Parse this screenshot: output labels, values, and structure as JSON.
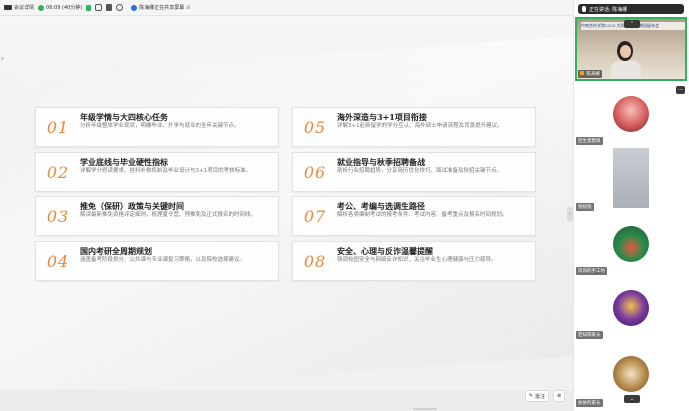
{
  "topbar": {
    "app_name": "会议详情",
    "meeting_time": "06:09 (40分钟)",
    "recording_label": "陈海娜正在共享屏幕"
  },
  "slide": {
    "items": [
      {
        "num": "01",
        "title": "年级学情与大四核心任务",
        "desc": "分析年级整体学业现状，明确毕业、升学与就业的全年关键节点。"
      },
      {
        "num": "02",
        "title": "学业底线与毕业硬性指标",
        "desc": "详解学分修读要求、挂科补救机制及毕业设计与3+1项目的考核标准。"
      },
      {
        "num": "03",
        "title": "推免（保研）政策与关键时间",
        "desc": "解读最新推免资格评定细则，梳理夏令营、预推免及正式报名的时间线。"
      },
      {
        "num": "04",
        "title": "国内考研全周期规划",
        "desc": "涵盖备考阶段划分、公共课与专业课复习策略，以及院校选择建议。"
      },
      {
        "num": "05",
        "title": "海外深造与3+1项目衔接",
        "desc": "详解3+1赴新留学的学分互认、海外硕士申请流程及背景提升建议。"
      },
      {
        "num": "06",
        "title": "就业指导与秋季招聘备战",
        "desc": "剖析行业招聘趋势，分享简历优化技巧、面试准备及秋招关键节点。"
      },
      {
        "num": "07",
        "title": "考公、考编与选调生路径",
        "desc": "解析各类编制考试的报考条件、考试内容、备考重点及报名时间规划。"
      },
      {
        "num": "08",
        "title": "安全、心理与反诈温馨提醒",
        "desc": "强调校园安全与网络反诈知识，关注毕业生心理健康与压力疏导。"
      }
    ]
  },
  "tools": {
    "annotate_label": "批注"
  },
  "sidebar": {
    "speaking_label": "正在讲话: 陈海娜",
    "banner_text": "中南合作学院2025-大四年级2学期班级年会",
    "participants": [
      {
        "name": "陈海娜"
      },
      {
        "name": "后生莫猥琐"
      },
      {
        "name": "锐锐锐"
      },
      {
        "name": "风风的手工坊"
      },
      {
        "name": "若知阳家长"
      },
      {
        "name": "依依的家长"
      }
    ]
  },
  "colors": {
    "accent_number": "#e8893a",
    "speaking_bg": "#2b2b2b"
  }
}
